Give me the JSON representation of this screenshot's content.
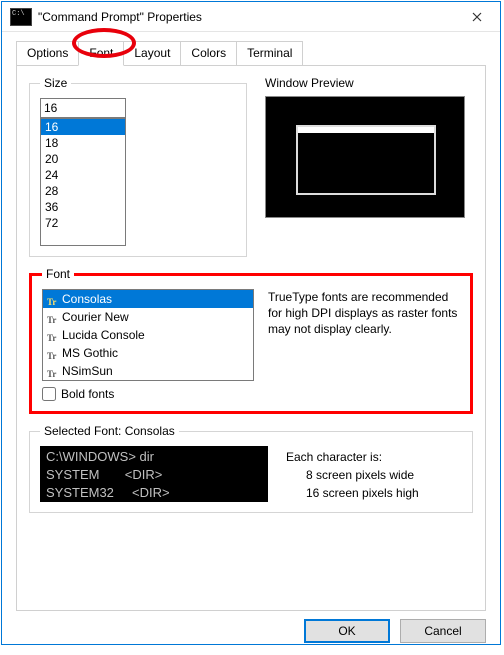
{
  "window": {
    "title": "\"Command Prompt\" Properties"
  },
  "tabs": {
    "options": "Options",
    "font": "Font",
    "layout": "Layout",
    "colors": "Colors",
    "terminal": "Terminal",
    "active": "Font"
  },
  "size": {
    "label": "Size",
    "value": "16",
    "items": [
      "16",
      "18",
      "20",
      "24",
      "28",
      "36",
      "72"
    ]
  },
  "preview": {
    "label": "Window Preview"
  },
  "fonts": {
    "label": "Font",
    "items": [
      "Consolas",
      "Courier New",
      "Lucida Console",
      "MS Gothic",
      "NSimSun"
    ],
    "selected": "Consolas",
    "bold_label": "Bold fonts",
    "advice": "TrueType fonts are recommended for high DPI displays as raster fonts may not display clearly."
  },
  "sample": {
    "legend": "Selected Font: Consolas",
    "line1": "C:\\WINDOWS> dir",
    "line2": "SYSTEM       <DIR>",
    "line3": "SYSTEM32     <DIR>",
    "info_head": "Each character is:",
    "info_w": "8 screen pixels wide",
    "info_h": "16 screen pixels high"
  },
  "buttons": {
    "ok": "OK",
    "cancel": "Cancel"
  }
}
